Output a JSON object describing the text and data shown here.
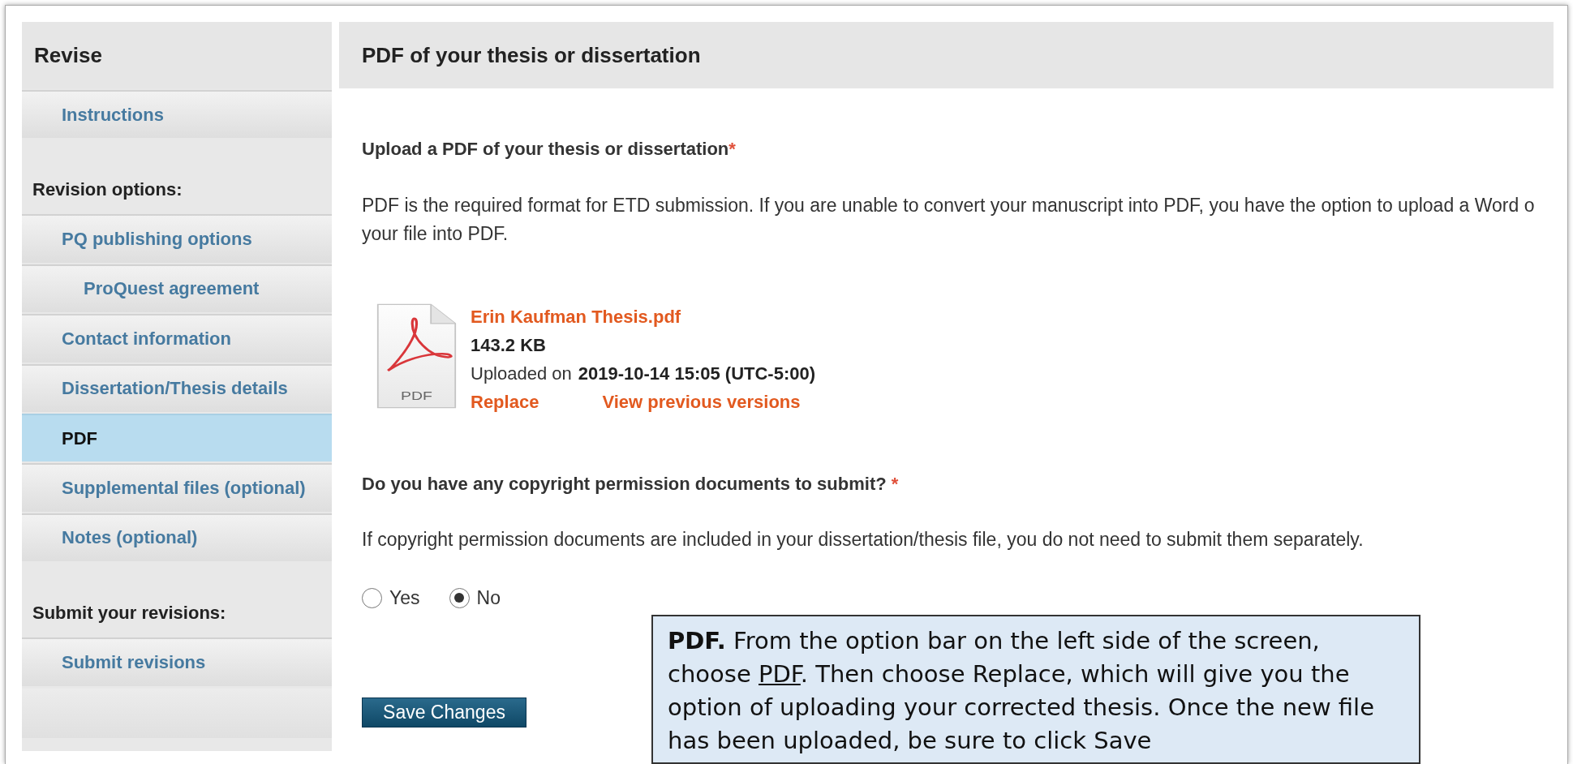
{
  "sidebar": {
    "title": "Revise",
    "items": [
      {
        "kind": "link",
        "label": "Instructions",
        "selected": false
      },
      {
        "kind": "heading",
        "label": "Revision options:"
      },
      {
        "kind": "link",
        "label": "PQ publishing options",
        "selected": false,
        "children": [
          {
            "kind": "link",
            "label": "ProQuest agreement",
            "selected": false
          }
        ]
      },
      {
        "kind": "link",
        "label": "Contact information",
        "selected": false
      },
      {
        "kind": "link",
        "label": "Dissertation/Thesis details",
        "selected": false
      },
      {
        "kind": "link",
        "label": "PDF",
        "selected": true
      },
      {
        "kind": "link",
        "label": "Supplemental files (optional)",
        "selected": false
      },
      {
        "kind": "link",
        "label": "Notes (optional)",
        "selected": false
      },
      {
        "kind": "heading",
        "label": "Submit your revisions:"
      },
      {
        "kind": "link",
        "label": "Submit revisions",
        "selected": false
      }
    ]
  },
  "main": {
    "title": "PDF of your thesis or dissertation",
    "upload": {
      "label": "Upload a PDF of your thesis or dissertation",
      "required_mark": "*",
      "description": [
        "PDF is the required format for ETD submission. If you are unable to convert your manuscript into PDF, you have the option to upload a Word o",
        "your file into PDF."
      ]
    },
    "file": {
      "icon_label": "PDF",
      "name": "Erin Kaufman Thesis.pdf",
      "size": "143.2 KB",
      "uploaded_label": "Uploaded on",
      "uploaded_at": "2019-10-14 15:05 (UTC-5:00)",
      "actions": [
        "Replace",
        "View previous versions"
      ]
    },
    "copyright": {
      "question": "Do you have any copyright permission documents to submit?",
      "required_mark": "*",
      "help": "If copyright permission documents are included in your dissertation/thesis file, you do not need to submit them separately.",
      "options": [
        {
          "label": "Yes",
          "selected": false
        },
        {
          "label": "No",
          "selected": true
        }
      ]
    },
    "save_button": "Save Changes"
  },
  "callout": {
    "segments": [
      {
        "kind": "bold",
        "text": "PDF."
      },
      {
        "kind": "plain",
        "text": " From the option bar on the left side of the screen, choose "
      },
      {
        "kind": "underline",
        "text": "PDF"
      },
      {
        "kind": "plain",
        "text": ". Then choose Replace, which will give you the option of uploading your corrected thesis. Once the new file has been uploaded, be sure to click Save"
      }
    ]
  }
}
